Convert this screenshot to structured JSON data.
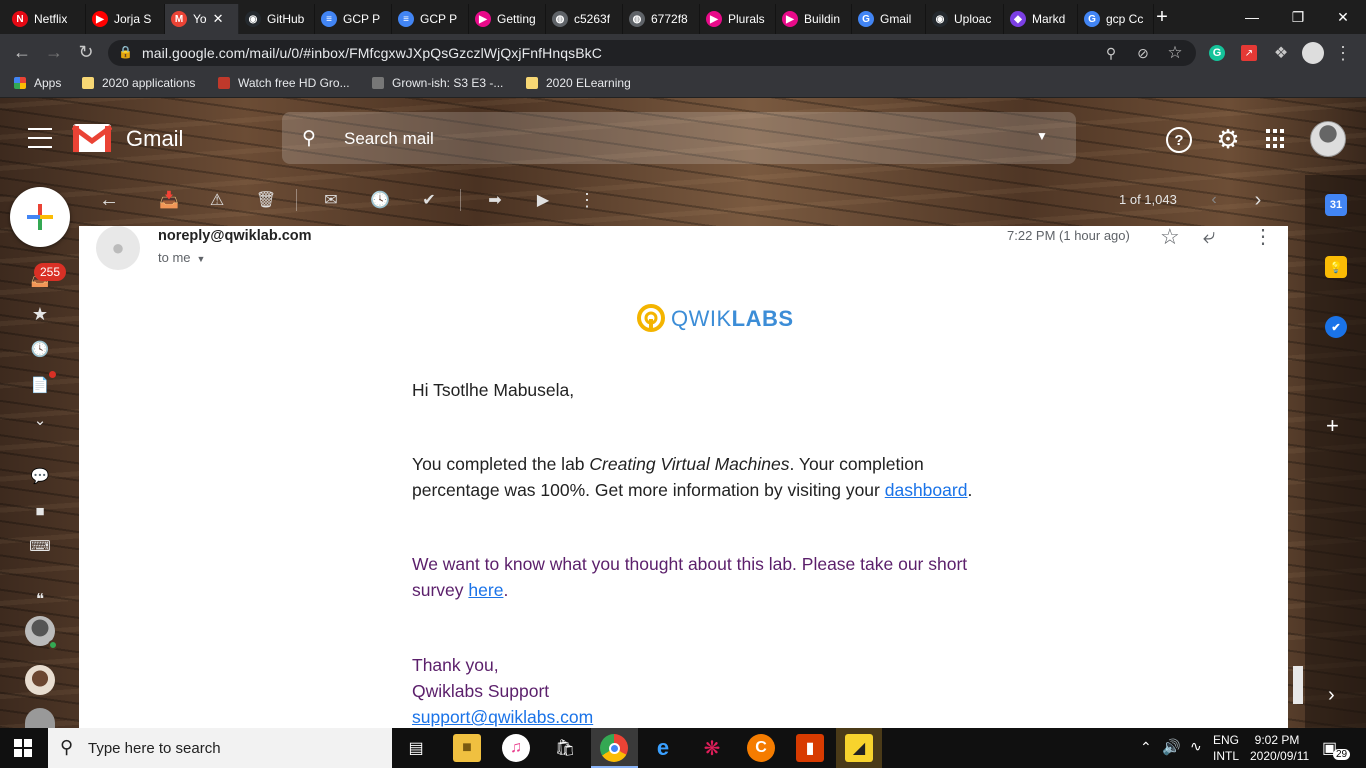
{
  "browser": {
    "tabs": [
      {
        "title": "Netflix",
        "icon": "netflix-icon",
        "color": "#e50914"
      },
      {
        "title": "Jorja S",
        "icon": "youtube-icon",
        "color": "#ff0000"
      },
      {
        "title": "Yo",
        "icon": "gmail-icon",
        "color": "#ea4335",
        "active": true
      },
      {
        "title": "GitHub",
        "icon": "github-icon",
        "color": "#24292e"
      },
      {
        "title": "GCP P",
        "icon": "docs-icon",
        "color": "#4285f4"
      },
      {
        "title": "GCP P",
        "icon": "docs-icon",
        "color": "#4285f4"
      },
      {
        "title": "Getting",
        "icon": "pluralsight-icon",
        "color": "#e80a89"
      },
      {
        "title": "c5263f",
        "icon": "globe-icon",
        "color": "#5f6368"
      },
      {
        "title": "6772f8",
        "icon": "globe-icon",
        "color": "#5f6368"
      },
      {
        "title": "Plurals",
        "icon": "pluralsight-icon",
        "color": "#e80a89"
      },
      {
        "title": "Buildin",
        "icon": "pluralsight-icon",
        "color": "#e80a89"
      },
      {
        "title": "Gmail",
        "icon": "google-icon",
        "color": "#4285f4"
      },
      {
        "title": "Uploac",
        "icon": "github-icon",
        "color": "#24292e"
      },
      {
        "title": "Markd",
        "icon": "shield-icon",
        "color": "#7b3fe4"
      },
      {
        "title": "gcp Cc",
        "icon": "google-icon",
        "color": "#4285f4"
      }
    ],
    "tab_close": "✕",
    "new_tab": "+",
    "url": "mail.google.com/mail/u/0/#inbox/FMfcgxwJXpQsGzczlWjQxjFnfHnqsBkC",
    "bookmarks": [
      {
        "label": "Apps",
        "icon": "apps-grid-icon"
      },
      {
        "label": "2020 applications",
        "icon": "folder-icon"
      },
      {
        "label": "Watch free HD Gro...",
        "icon": "video-icon"
      },
      {
        "label": "Grown-ish: S3 E3 -...",
        "icon": "site-icon"
      },
      {
        "label": "2020 ELearning",
        "icon": "folder-icon"
      }
    ]
  },
  "gmail": {
    "logo_text": "Gmail",
    "search_placeholder": "Search mail",
    "inbox_badge": "255",
    "pagination": "1 of 1,043",
    "compose_label": "+"
  },
  "message": {
    "sender": "noreply@qwiklab.com",
    "to_line": "to me",
    "timestamp": "7:22 PM (1 hour ago)",
    "brand": {
      "q": "QWIK",
      "l": "LABS",
      "q_color": "#3c8dd7",
      "accent": "#f4b400"
    },
    "greeting": "Hi Tsotlhe Mabusela,",
    "p1_a": "You completed the lab ",
    "p1_lab": "Creating Virtual Machines",
    "p1_b": ". Your completion percentage was 100%. Get more information by visiting your ",
    "p1_link": "dashboard",
    "p1_c": ".",
    "p2_a": "We want to know what you thought about this lab. Please take our short survey ",
    "p2_link": "here",
    "p2_b": ".",
    "thanks": "Thank you,",
    "signoff": "Qwiklabs Support",
    "support_email": "support@qwiklabs.com"
  },
  "side_apps": [
    "calendar-icon",
    "keep-icon",
    "tasks-icon",
    "add-addon-icon"
  ],
  "calendar_day": "31",
  "taskbar": {
    "search_placeholder": "Type here to search",
    "lang": "ENG",
    "lang2": "INTL",
    "time": "9:02 PM",
    "date": "2020/09/11",
    "notif": "29"
  }
}
